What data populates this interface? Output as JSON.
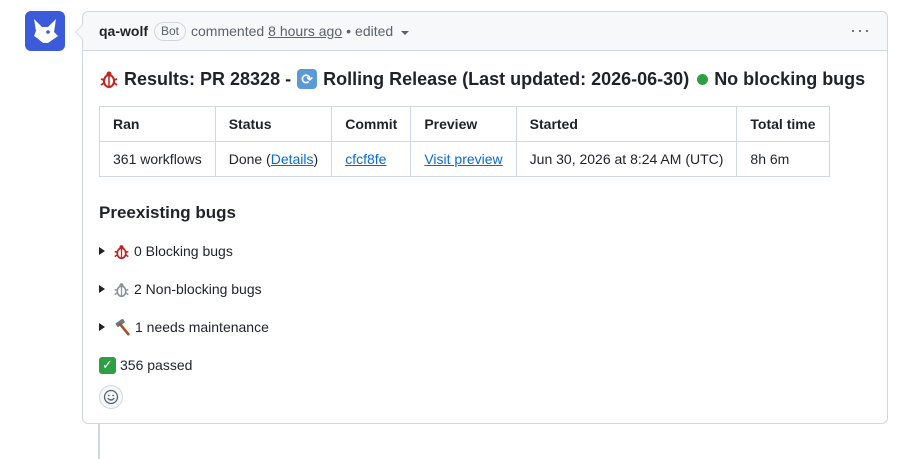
{
  "header": {
    "author": "qa-wolf",
    "badge": "Bot",
    "action": "commented",
    "timestamp": "8 hours ago",
    "separator": "•",
    "edited": "edited",
    "menu": "···"
  },
  "title": {
    "prefix": "Results: PR 28328 -",
    "release": "Rolling Release (Last updated: 2026-06-30)",
    "status": "No blocking bugs",
    "status_color": "#2ea043"
  },
  "table": {
    "headers": [
      "Ran",
      "Status",
      "Commit",
      "Preview",
      "Started",
      "Total time"
    ],
    "row": {
      "ran": "361 workflows",
      "status_prefix": "Done (",
      "status_link": "Details",
      "status_suffix": ")",
      "commit": "cfcf8fe",
      "preview": "Visit preview",
      "started": "Jun 30, 2026 at 8:24 AM (UTC)",
      "total_time": "8h 6m"
    }
  },
  "preexisting": {
    "heading": "Preexisting bugs",
    "items": [
      {
        "label": "0 Blocking bugs",
        "icon": "bug-red-icon"
      },
      {
        "label": "2 Non-blocking bugs",
        "icon": "bug-gray-icon"
      },
      {
        "label": "1 needs maintenance",
        "icon": "hammer-icon"
      }
    ]
  },
  "passed": {
    "label": "356 passed",
    "icon": "check-mark-icon"
  },
  "colors": {
    "avatar_bg": "#3b5bdb",
    "link": "#0969da",
    "bug_red": "#c5221f"
  }
}
